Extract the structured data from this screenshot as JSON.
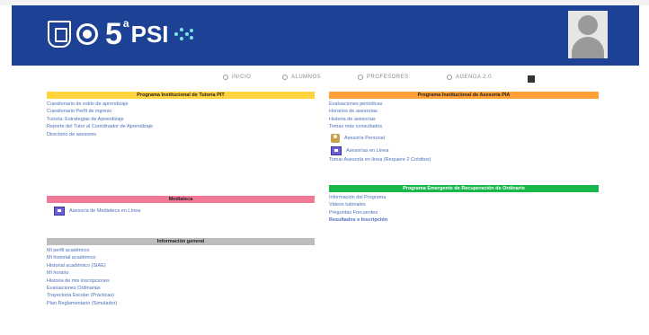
{
  "brand": {
    "five": "5",
    "sup": "a",
    "psi": "PSI"
  },
  "nav": [
    {
      "label": "INICIO"
    },
    {
      "label": "ALUMNOS"
    },
    {
      "label": "PROFESORES"
    },
    {
      "label": "AGENDA 2.0"
    }
  ],
  "left": {
    "tutoria": {
      "header": "Programa Institucional de Tutoría PIT",
      "links": [
        "Cuestionario de estilo de aprendizaje",
        "Cuestionario Perfil de ingreso",
        "Tutoría: Estrategias de Aprendizaje",
        "Reporte del Tutor al Coordinador de Aprendizaje",
        "Directorio de asesores"
      ]
    },
    "mediateca": {
      "header": "Mediateca",
      "link": "Asesoría de Mediateca en Línea"
    },
    "info": {
      "header": "Información general",
      "links": [
        "Mi perfil académico",
        "Mi historial académico",
        "Historial académico (SIAE)",
        "Mi horario",
        "Historia de mis inscripciones",
        "Evaluaciones Ordinarias",
        "Trayectoria Escolar (Prácticas)",
        "Plan Reglamentario (Simulador)"
      ]
    }
  },
  "right": {
    "asesoria": {
      "header": "Programa Institucional de Asesoría PIA",
      "links": [
        "Evaluaciones periódicas",
        "Horarios de asesorías",
        "Historia de asesorías",
        "Temas más consultados"
      ],
      "icon_link_person": "Asesoría Personal",
      "icon_link_online": "Asesorías en Línea",
      "after": "Tomar Asesoría en línea (Requiere 2 Créditos)"
    },
    "recuperacion": {
      "header": "Programa Emergente de Recuperación de Ordinario",
      "links": [
        "Información del Programa",
        "Videos tutoriales",
        "Preguntas Frecuentes"
      ],
      "bold_link": "Resultados e Inscripción"
    }
  },
  "colors": {
    "header_blue": "#1d4194",
    "yellow": "#ffd33d",
    "orange": "#ffa037",
    "pink": "#f07896",
    "gray": "#bdbdbd",
    "green": "#16b84a",
    "link": "#4a6fb8"
  },
  "icons": [
    "unam-shield-icon",
    "circle-logo-icon",
    "dots-icon",
    "user-avatar-icon",
    "home-icon",
    "students-icon",
    "teachers-icon",
    "agenda-icon",
    "monitor-icon",
    "person-icon"
  ]
}
